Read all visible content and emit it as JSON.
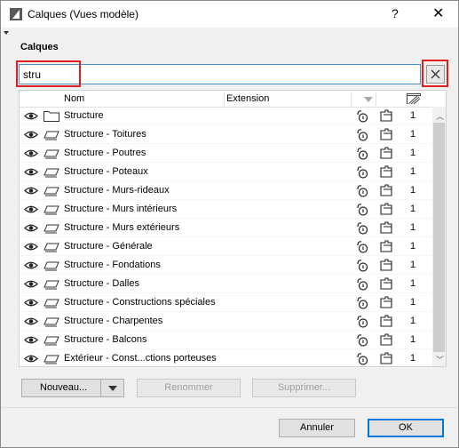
{
  "window": {
    "title": "Calques (Vues modèle)",
    "help": "?",
    "close": "✕"
  },
  "section": {
    "label": "Calques"
  },
  "search": {
    "value": "stru",
    "clear_label": "✕"
  },
  "table": {
    "headers": {
      "name": "Nom",
      "extension": "Extension"
    },
    "rows": [
      {
        "name": "Structure",
        "type": "folder",
        "value": "1"
      },
      {
        "name": "Structure - Toitures",
        "type": "layer",
        "value": "1"
      },
      {
        "name": "Structure - Poutres",
        "type": "layer",
        "value": "1"
      },
      {
        "name": "Structure - Poteaux",
        "type": "layer",
        "value": "1"
      },
      {
        "name": "Structure - Murs-rideaux",
        "type": "layer",
        "value": "1"
      },
      {
        "name": "Structure - Murs intérieurs",
        "type": "layer",
        "value": "1"
      },
      {
        "name": "Structure - Murs extérieurs",
        "type": "layer",
        "value": "1"
      },
      {
        "name": "Structure - Générale",
        "type": "layer",
        "value": "1"
      },
      {
        "name": "Structure - Fondations",
        "type": "layer",
        "value": "1"
      },
      {
        "name": "Structure - Dalles",
        "type": "layer",
        "value": "1"
      },
      {
        "name": "Structure - Constructions spéciales",
        "type": "layer",
        "value": "1"
      },
      {
        "name": "Structure - Charpentes",
        "type": "layer",
        "value": "1"
      },
      {
        "name": "Structure - Balcons",
        "type": "layer",
        "value": "1"
      },
      {
        "name": "Extérieur - Const...ctions porteuses",
        "type": "layer",
        "value": "1"
      }
    ]
  },
  "buttons": {
    "new": "Nouveau...",
    "rename": "Renommer",
    "delete": "Supprimer...",
    "cancel": "Annuler",
    "ok": "OK"
  },
  "colors": {
    "highlight": "#e02020",
    "focus": "#0078d7"
  }
}
